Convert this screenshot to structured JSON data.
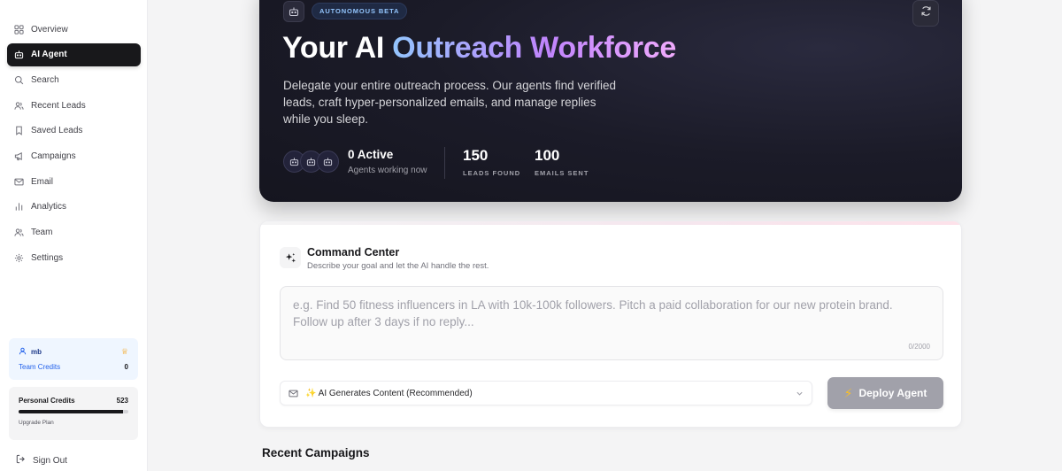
{
  "sidebar": {
    "items": [
      {
        "label": "Overview",
        "icon": "grid-icon"
      },
      {
        "label": "AI Agent",
        "icon": "bot-icon",
        "active": true
      },
      {
        "label": "Search",
        "icon": "search-icon"
      },
      {
        "label": "Recent Leads",
        "icon": "users-icon"
      },
      {
        "label": "Saved Leads",
        "icon": "bookmark-icon"
      },
      {
        "label": "Campaigns",
        "icon": "megaphone-icon"
      },
      {
        "label": "Email",
        "icon": "mail-icon"
      },
      {
        "label": "Analytics",
        "icon": "bar-chart-icon"
      },
      {
        "label": "Team",
        "icon": "users-icon"
      },
      {
        "label": "Settings",
        "icon": "gear-icon"
      }
    ],
    "team": {
      "name": "mb",
      "credits_label": "Team Credits",
      "credits": "0"
    },
    "personal": {
      "label": "Personal Credits",
      "credits": "523",
      "progress_fraction": 0.95,
      "upgrade": "Upgrade Plan"
    },
    "signout": "Sign Out"
  },
  "hero": {
    "badge": "AUTONOMOUS BETA",
    "title_plain": "Your AI",
    "title_gradient": "Outreach Workforce",
    "description": "Delegate your entire outreach process. Our agents find verified leads, craft hyper-personalized emails, and manage replies while you sleep.",
    "active_count": "0 Active",
    "active_sub": "Agents working now",
    "leads_value": "150",
    "leads_label": "LEADS FOUND",
    "emails_value": "100",
    "emails_label": "EMAILS SENT"
  },
  "command": {
    "title": "Command Center",
    "subtitle": "Describe your goal and let the AI handle the rest.",
    "placeholder": "e.g. Find 50 fitness influencers in LA with 10k-100k followers. Pitch a paid collaboration for our new protein brand. Follow up after 3 days if no reply...",
    "value": "",
    "counter": "0/2000",
    "mode_selected": "✨ AI Generates Content (Recommended)",
    "deploy_label": "Deploy Agent"
  },
  "recent": {
    "title": "Recent Campaigns"
  },
  "colors": {
    "accent_dark": "#18181b",
    "hero_bg": "#1b1b28",
    "gradient_start": "#93c5fd",
    "gradient_end": "#f0abfc",
    "deploy_disabled": "#a1a1aa"
  }
}
